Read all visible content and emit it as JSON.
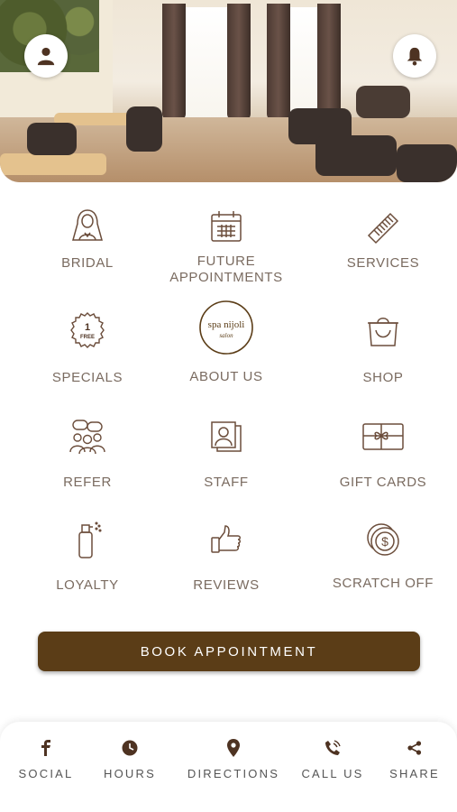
{
  "app": {
    "brand_colors": {
      "primary": "#5b3d17",
      "icon": "#6b4d3b",
      "label": "#7a6b60"
    }
  },
  "header": {
    "profile_icon": "user-icon",
    "notification_icon": "bell-icon"
  },
  "logo": {
    "line1": "spa nijoli",
    "line2": "salon"
  },
  "grid": [
    {
      "label": "BRIDAL",
      "icon": "bride-icon"
    },
    {
      "label": "FUTURE APPOINTMENTS",
      "icon": "calendar-icon"
    },
    {
      "label": "SERVICES",
      "icon": "comb-icon"
    },
    {
      "label": "SPECIALS",
      "icon": "one-free-badge-icon"
    },
    {
      "label": "ABOUT US",
      "icon": "logo"
    },
    {
      "label": "SHOP",
      "icon": "shopping-bag-icon"
    },
    {
      "label": "REFER",
      "icon": "refer-people-icon"
    },
    {
      "label": "STAFF",
      "icon": "staff-photos-icon"
    },
    {
      "label": "GIFT CARDS",
      "icon": "gift-card-icon"
    },
    {
      "label": "LOYALTY",
      "icon": "spray-bottle-icon"
    },
    {
      "label": "REVIEWS",
      "icon": "thumbs-up-icon"
    },
    {
      "label": "SCRATCH OFF",
      "icon": "coins-icon"
    }
  ],
  "badge_text": {
    "one": "1",
    "free": "FREE"
  },
  "book_button": {
    "label": "BOOK APPOINTMENT"
  },
  "bottom_nav": [
    {
      "label": "SOCIAL",
      "icon": "facebook-icon"
    },
    {
      "label": "HOURS",
      "icon": "clock-icon"
    },
    {
      "label": "DIRECTIONS",
      "icon": "map-pin-icon"
    },
    {
      "label": "CALL US",
      "icon": "phone-icon"
    },
    {
      "label": "SHARE",
      "icon": "share-icon"
    }
  ]
}
